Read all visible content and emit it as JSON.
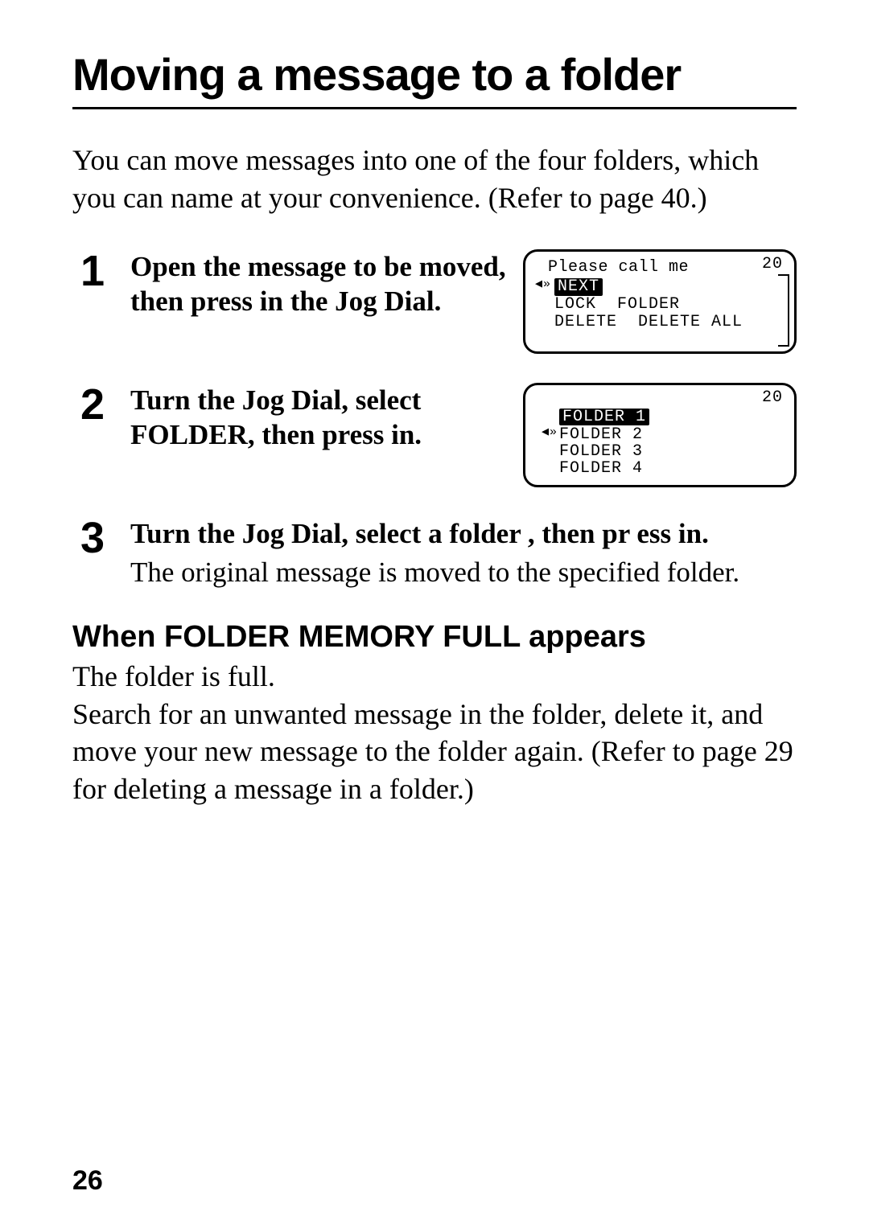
{
  "title": "Moving a message to a folder",
  "intro": "You can move messages into one of the four folders, which you can name at your convenience. (Refer to page 40.)",
  "steps": [
    {
      "num": "1",
      "head": "Open the message to be moved, then press in the Jog Dial.",
      "lcd": {
        "count": "20",
        "message": "Please call me",
        "menu": [
          [
            "NEXT",
            ""
          ],
          [
            "LOCK",
            "FOLDER"
          ],
          [
            "DELETE",
            "DELETE ALL"
          ]
        ],
        "highlight": "NEXT"
      }
    },
    {
      "num": "2",
      "head": "Turn the Jog Dial, select  FOLDER,  then press  in.",
      "lcd": {
        "count": "20",
        "folders": [
          "FOLDER 1",
          "FOLDER 2",
          "FOLDER 3",
          "FOLDER 4"
        ],
        "selected": "FOLDER 1",
        "speaker_row": "FOLDER 2"
      }
    },
    {
      "num": "3",
      "head": "Turn the Jog Dial, select a folder , then pr ess in.",
      "desc": "The original message is moved to the specified folder."
    }
  ],
  "section": {
    "head": "When FOLDER MEMORY FULL appears",
    "body": "The folder is full.\nSearch for an unwanted message in the folder, delete it, and move your new message to the folder again. (Refer to page 29 for deleting a message in a folder.)"
  },
  "page_number": "26"
}
